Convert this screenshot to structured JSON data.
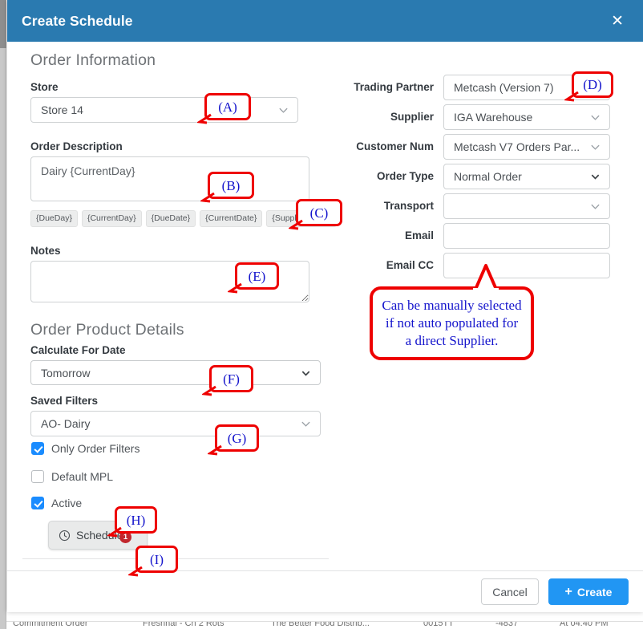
{
  "modal": {
    "title": "Create Schedule",
    "close_icon": "close-icon"
  },
  "left": {
    "section_title": "Order Information",
    "store": {
      "label": "Store",
      "value": "Store 14"
    },
    "order_description": {
      "label": "Order Description",
      "value": "Dairy {CurrentDay}",
      "tokens": [
        "{DueDay}",
        "{CurrentDay}",
        "{DueDate}",
        "{CurrentDate}",
        "{SupplierName}"
      ]
    },
    "notes": {
      "label": "Notes",
      "value": "",
      "placeholder": ""
    },
    "product_details_title": "Order Product Details",
    "calculate_for_date": {
      "label": "Calculate For Date",
      "value": "Tomorrow"
    },
    "saved_filters": {
      "label": "Saved Filters",
      "value": "AO- Dairy"
    },
    "checkboxes": [
      {
        "label": "Only Order Filters",
        "checked": true
      },
      {
        "label": "Default MPL",
        "checked": false
      },
      {
        "label": "Active",
        "checked": true
      }
    ],
    "schedule_button": {
      "label": "Schedule",
      "badge": "1",
      "icon": "clock-icon"
    }
  },
  "right": {
    "fields": [
      {
        "label": "Trading Partner",
        "value": "Metcash (Version 7)"
      },
      {
        "label": "Supplier",
        "value": "IGA Warehouse"
      },
      {
        "label": "Customer Num",
        "value": "Metcash V7 Orders Par..."
      },
      {
        "label": "Order Type",
        "value": "Normal Order"
      },
      {
        "label": "Transport",
        "value": ""
      },
      {
        "label": "Email",
        "value": ""
      },
      {
        "label": "Email CC",
        "value": ""
      }
    ]
  },
  "footer": {
    "cancel_label": "Cancel",
    "create_label": "Create",
    "create_icon": "plus-icon"
  },
  "annotations": {
    "a": "(A)",
    "b": "(B)",
    "c": "(C)",
    "d": "(D)",
    "e": "(E)",
    "f": "(F)",
    "g": "(G)",
    "h": "(H)",
    "i": "(I)",
    "callout": "Can be manually selected if not auto populated for a direct Supplier."
  },
  "background_row": {
    "cells": [
      "Commitment Order",
      "Freshnal - Cn 2 Rots",
      "The Better Food Distrib...",
      "0015TT",
      "-4837",
      "At 04:40 PM"
    ]
  },
  "colors": {
    "header_blue": "#2a7ab0",
    "accent_blue": "#2196f3",
    "checkbox_blue": "#1a8cff",
    "annotation_red": "#ee0000",
    "annotation_text": "#1414cc",
    "badge_red": "#c1272d"
  }
}
